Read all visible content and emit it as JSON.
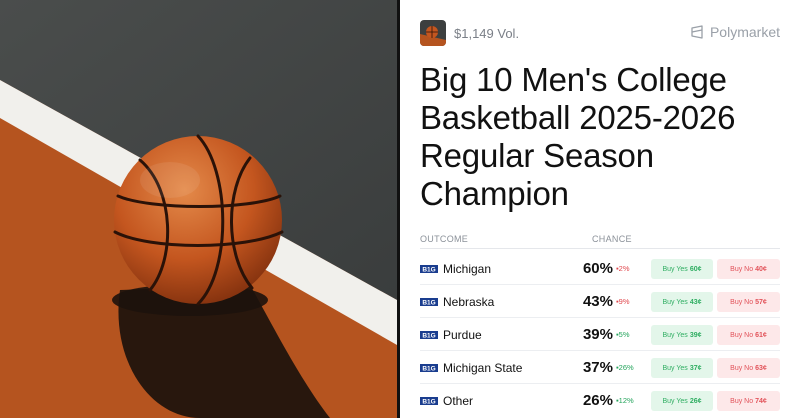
{
  "header": {
    "volume": "$1,149 Vol.",
    "brand": "Polymarket",
    "thumbnail_icon": "basketball-thumbnail-icon",
    "brand_icon": "polymarket-logo-icon"
  },
  "market": {
    "title": "Big 10 Men's College Basketball 2025-2026 Regular Season Champion"
  },
  "table": {
    "columns": {
      "outcome": "OUTCOME",
      "chance": "CHANCE"
    },
    "rows": [
      {
        "name": "Michigan",
        "chance": "60%",
        "delta": "▪2%",
        "direction": "down",
        "yes_label": "Buy Yes",
        "yes_price": "60¢",
        "no_label": "Buy No",
        "no_price": "40¢"
      },
      {
        "name": "Nebraska",
        "chance": "43%",
        "delta": "▪9%",
        "direction": "down",
        "yes_label": "Buy Yes",
        "yes_price": "43¢",
        "no_label": "Buy No",
        "no_price": "57¢"
      },
      {
        "name": "Purdue",
        "chance": "39%",
        "delta": "▪5%",
        "direction": "up",
        "yes_label": "Buy Yes",
        "yes_price": "39¢",
        "no_label": "Buy No",
        "no_price": "61¢"
      },
      {
        "name": "Michigan State",
        "chance": "37%",
        "delta": "▪26%",
        "direction": "up",
        "yes_label": "Buy Yes",
        "yes_price": "37¢",
        "no_label": "Buy No",
        "no_price": "63¢"
      },
      {
        "name": "Other",
        "chance": "26%",
        "delta": "▪12%",
        "direction": "up",
        "yes_label": "Buy Yes",
        "yes_price": "26¢",
        "no_label": "Buy No",
        "no_price": "74¢"
      }
    ]
  },
  "colors": {
    "up": "#22a35a",
    "down": "#e0464c",
    "yes_bg": "#e3f6ea",
    "no_bg": "#fde8e9"
  }
}
